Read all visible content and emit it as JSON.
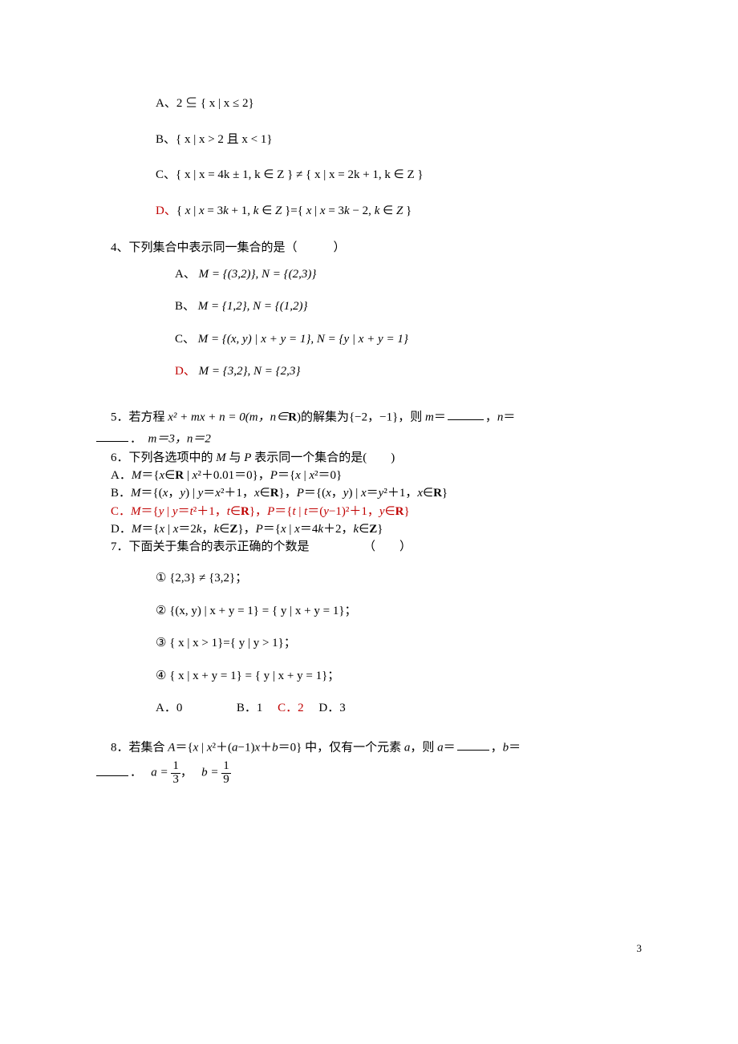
{
  "q3": {
    "A": "A、2 ⊆ { x | x ≤ 2}",
    "B": "B、{ x | x > 2 且 x < 1}",
    "C": "C、{ x | x = 4k ± 1, k ∈ Z } ≠ { x | x = 2k + 1, k ∈ Z }",
    "D": "D、{ x | x = 3k + 1, k ∈ Z }={ x | x = 3k − 2, k ∈ Z }",
    "D_prefix": "D、"
  },
  "q4": {
    "stem": "4、下列集合中表示同一集合的是（　　　）",
    "A": "M = {(3,2)}, N = {(2,3)}",
    "A_prefix": "A、",
    "B": "M = {1,2}, N = {(1,2)}",
    "B_prefix": "B、",
    "C": "M = {(x, y) | x + y = 1}, N = {y | x + y = 1}",
    "C_prefix": "C、",
    "D": "M = {3,2}, N = {2,3}",
    "D_prefix": "D、"
  },
  "q5": {
    "pre": "5．若方程 ",
    "mid1": "x² + mx + n = 0(m，n∈",
    "R": "R",
    "mid2": ")的解集为{−2，−1}，则 ",
    "m": "m",
    "eq1": "＝",
    "comma": "，",
    "n": "n",
    "eq2": "＝",
    "period": "．",
    "ans": "m＝3，n＝2"
  },
  "q6": {
    "stem1": "6．下列各选项中的 ",
    "M": "M",
    "stem2": " 与 ",
    "P": "P",
    "stem3": " 表示同一个集合的是(　　)",
    "A": "A．M＝{x∈R | x²＋0.01＝0}，P＝{x | x²＝0}",
    "B": "B．M＝{(x，y) | y＝x²＋1，x∈R}，P＝{(x，y) | x＝y²＋1，x∈R}",
    "C": "C．M＝{y | y＝t²＋1，t∈R}，P＝{t | t＝(y−1)²＋1，y∈R}",
    "D": "D．M＝{x | x＝2k，k∈Z}，P＝{x | x＝4k＋2，k∈Z}"
  },
  "q7": {
    "stem": "7．下面关于集合的表示正确的个数是　　　　　（　　）",
    "i1": "① {2,3} ≠ {3,2}；",
    "i2": "② {(x, y) | x + y = 1} = { y | x + y = 1}；",
    "i3": "③ { x | x > 1}={ y | y > 1}；",
    "i4": "④ { x | x + y = 1} = { y | x + y = 1}；",
    "optA": "A．0",
    "optB": "B．1",
    "optC": "C．2",
    "optD": "D．3"
  },
  "q8": {
    "pre": "8．若集合 A＝{x | x²＋(a−1)x＋b＝0} 中，仅有一个元素 a，则 ",
    "a": "a",
    "eq1": "＝",
    "comma": "，",
    "b": "b",
    "eq2": "＝",
    "period": "．",
    "ans_a_pre": "a = ",
    "frac1n": "1",
    "frac1d": "3",
    "ans_sep": "，",
    "ans_b_pre": "b = ",
    "frac2n": "1",
    "frac2d": "9"
  },
  "pagenum": "3"
}
